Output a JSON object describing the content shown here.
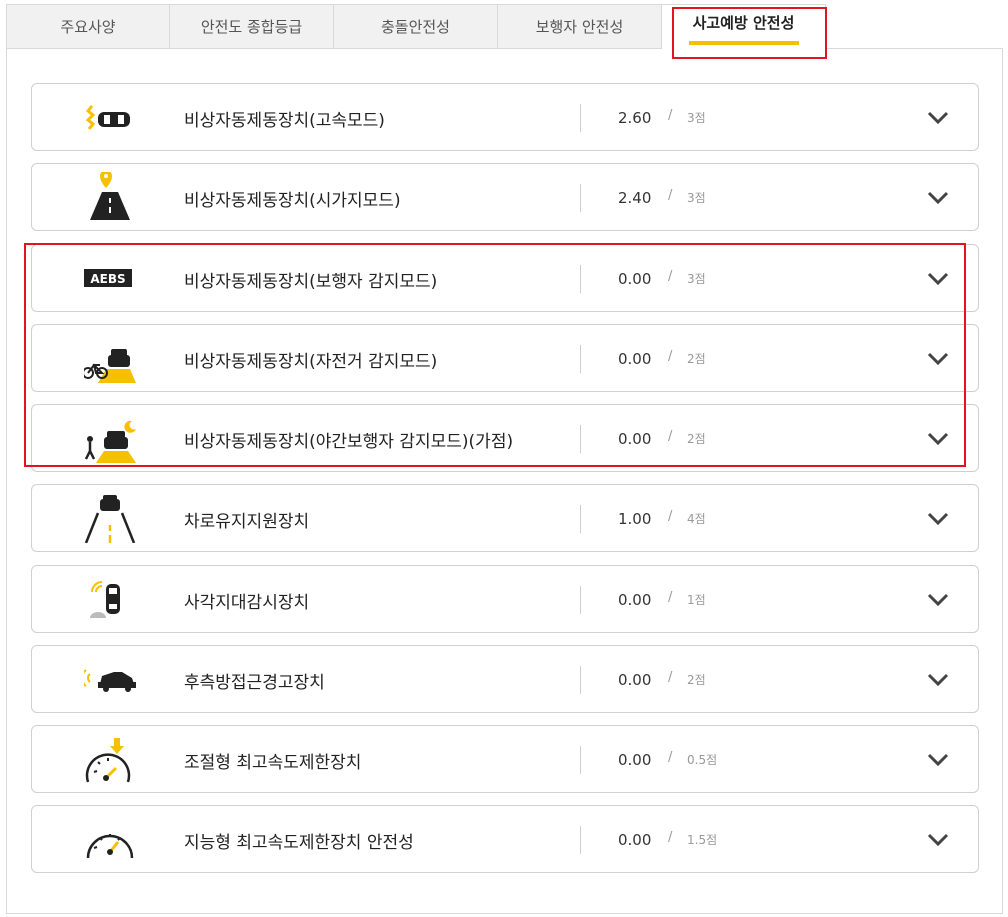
{
  "tabs": [
    {
      "label": "주요사양"
    },
    {
      "label": "안전도 종합등급"
    },
    {
      "label": "충돌안전성"
    },
    {
      "label": "보행자 안전성"
    },
    {
      "label": "사고예방 안전성",
      "active": true
    }
  ],
  "accent_color": "#f6c000",
  "highlight_color": "#e0161e",
  "items": [
    {
      "label": "비상자동제동장치(고속모드)",
      "score": "2.60",
      "slash": "/",
      "max": "3점",
      "icon": "car-collision-icon"
    },
    {
      "label": "비상자동제동장치(시가지모드)",
      "score": "2.40",
      "slash": "/",
      "max": "3점",
      "icon": "road-pin-icon"
    },
    {
      "label": "비상자동제동장치(보행자 감지모드)",
      "score": "0.00",
      "slash": "/",
      "max": "3점",
      "icon": "aebs-badge-icon",
      "badge_text": "AEBS"
    },
    {
      "label": "비상자동제동장치(자전거 감지모드)",
      "score": "0.00",
      "slash": "/",
      "max": "2점",
      "icon": "bicycle-car-icon"
    },
    {
      "label": "비상자동제동장치(야간보행자 감지모드)(가점)",
      "score": "0.00",
      "slash": "/",
      "max": "2점",
      "icon": "night-pedestrian-car-icon"
    },
    {
      "label": "차로유지지원장치",
      "score": "1.00",
      "slash": "/",
      "max": "4점",
      "icon": "lane-keeping-icon"
    },
    {
      "label": "사각지대감시장치",
      "score": "0.00",
      "slash": "/",
      "max": "1점",
      "icon": "blind-spot-icon"
    },
    {
      "label": "후측방접근경고장치",
      "score": "0.00",
      "slash": "/",
      "max": "2점",
      "icon": "rear-cross-alert-icon"
    },
    {
      "label": "조절형 최고속도제한장치",
      "score": "0.00",
      "slash": "/",
      "max": "0.5점",
      "icon": "adjustable-speed-limiter-icon"
    },
    {
      "label": "지능형 최고속도제한장치 안전성",
      "score": "0.00",
      "slash": "/",
      "max": "1.5점",
      "icon": "intelligent-speed-limiter-icon"
    }
  ]
}
